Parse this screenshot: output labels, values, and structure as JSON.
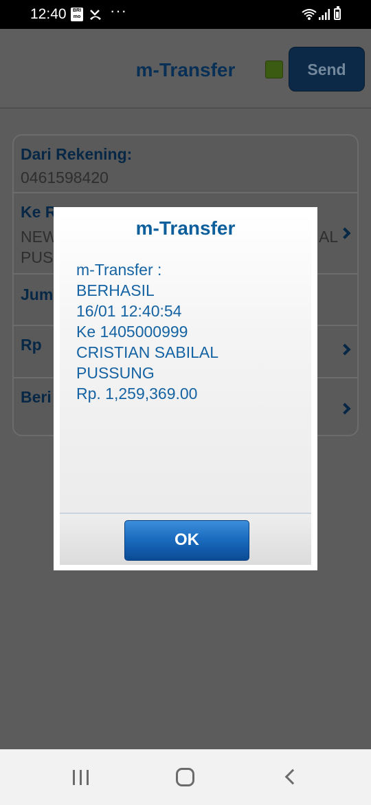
{
  "status_bar": {
    "time": "12:40",
    "app_icon_text": "BRI mo",
    "more": "···",
    "icons": [
      "bri-mo-app-icon",
      "missed-call-icon",
      "more-icon",
      "wifi-icon",
      "signal-icon",
      "battery-icon"
    ]
  },
  "header": {
    "title": "m-Transfer",
    "send_label": "Send",
    "indicator_color": "#78b82a"
  },
  "form": {
    "rows": [
      {
        "label": "Dari Rekening:",
        "value": "0461598420"
      },
      {
        "label": "Ke R",
        "value_line1": "NEW",
        "value_line1_right": "AL",
        "value_line2": "PUS"
      },
      {
        "label": "Jum"
      },
      {
        "label": "Rp"
      },
      {
        "label": "Beri"
      }
    ]
  },
  "dialog": {
    "title": "m-Transfer",
    "message_lines": [
      "m-Transfer :",
      "BERHASIL",
      "16/01 12:40:54",
      "Ke 1405000999",
      "CRISTIAN SABILAL",
      "PUSSUNG",
      "Rp. 1,259,369.00"
    ],
    "ok_label": "OK"
  },
  "colors": {
    "accent": "#0d5f9c",
    "ok_button": "#1b6cc0",
    "overlay": "#5c5c5c"
  },
  "nav_bar": {
    "icons": [
      "recent-apps-icon",
      "home-icon",
      "back-icon"
    ]
  }
}
